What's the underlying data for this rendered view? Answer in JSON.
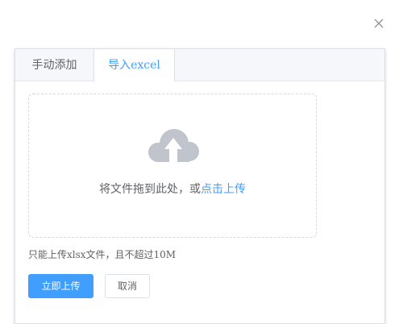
{
  "tabs": [
    {
      "label": "手动添加",
      "active": false
    },
    {
      "label": "导入excel",
      "active": true
    }
  ],
  "upload": {
    "icon": "upload-cloud-icon",
    "drop_text": "将文件拖到此处，或",
    "link_text": "点击上传",
    "tip": "只能上传xlsx文件，且不超过10M"
  },
  "buttons": {
    "submit_label": "立即上传",
    "cancel_label": "取消"
  },
  "colors": {
    "accent": "#409eff",
    "icon": "#c0c4cc",
    "text": "#606266",
    "border": "#dcdfe6"
  }
}
